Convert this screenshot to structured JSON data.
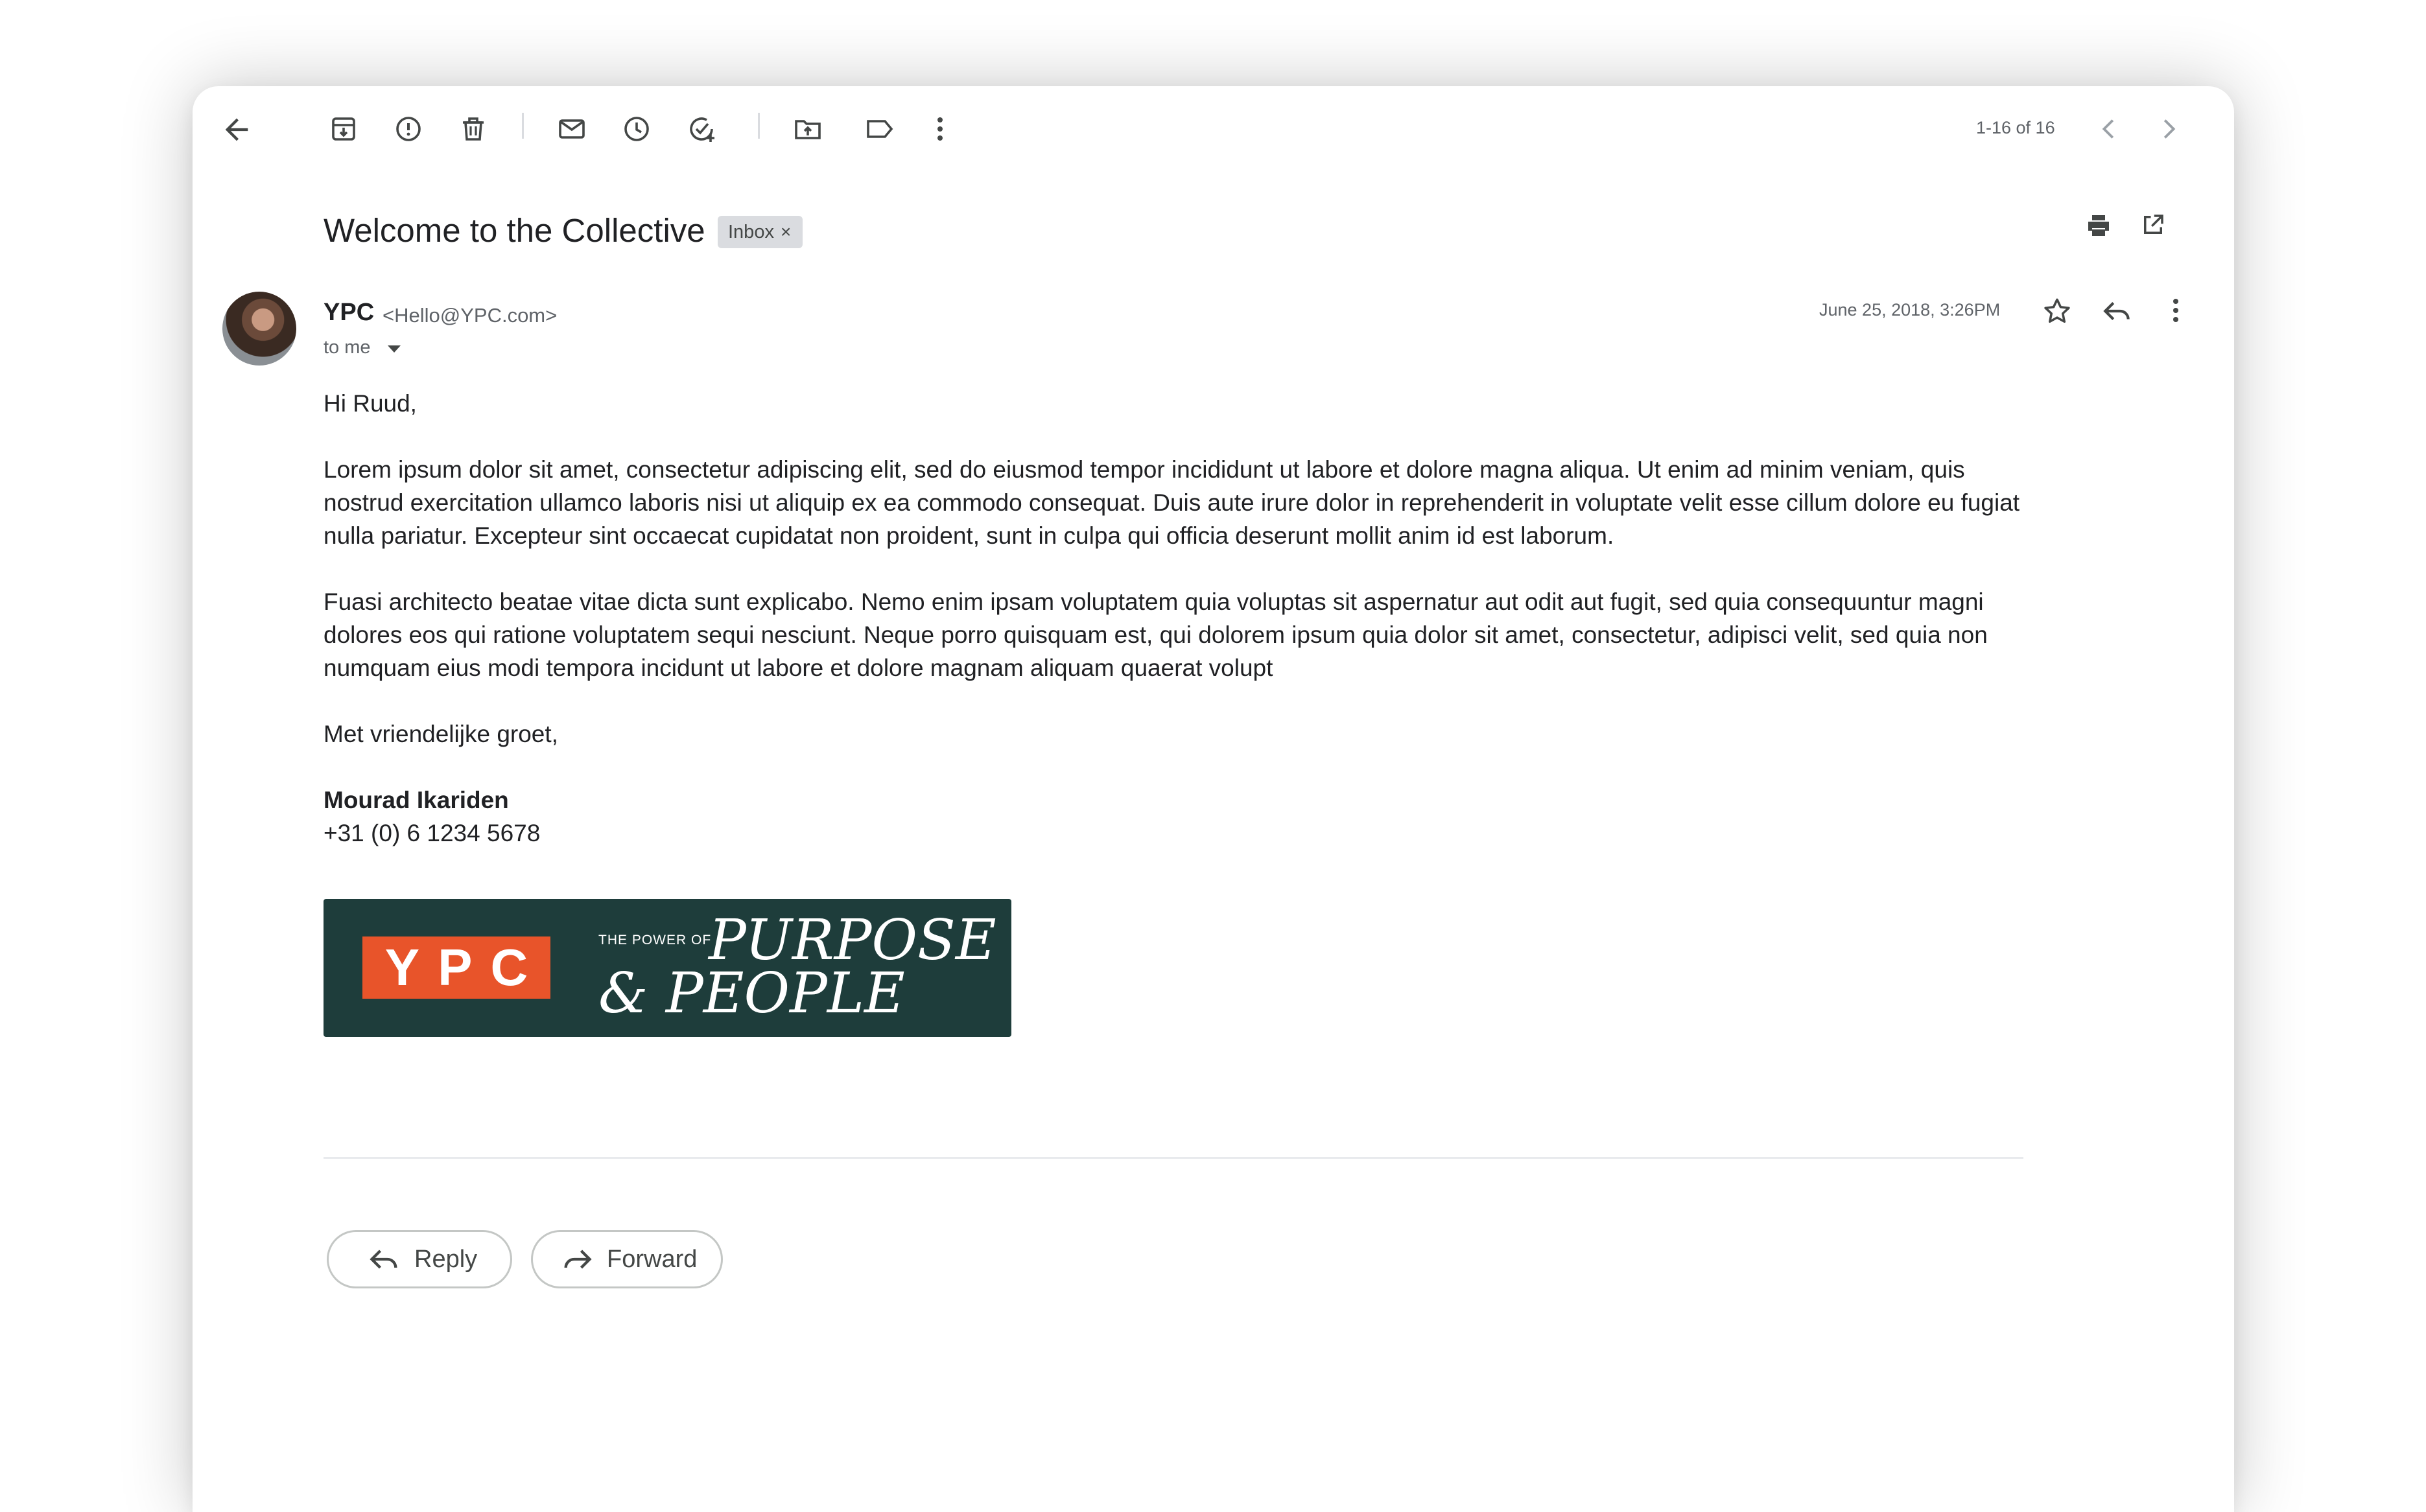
{
  "toolbar": {
    "icons": [
      "back-arrow-icon",
      "archive-icon",
      "report-spam-icon",
      "delete-icon",
      "mark-unread-icon",
      "snooze-icon",
      "add-task-icon",
      "move-to-icon",
      "label-icon",
      "more-vert-icon"
    ],
    "pager": "1-16 of 16"
  },
  "message": {
    "subject": "Welcome to the Collective",
    "label": "Inbox",
    "label_close": "×",
    "sender_name": "YPC",
    "sender_email": "<Hello@YPC.com>",
    "recipient": "to me",
    "date": "June 25, 2018, 3:26PM",
    "greeting": "Hi Ruud,",
    "paragraph1": "Lorem ipsum dolor sit amet, consectetur adipiscing elit, sed do eiusmod tempor incididunt ut labore et dolore magna aliqua. Ut enim ad minim veniam, quis nostrud exercitation ullamco laboris nisi ut aliquip ex ea commodo consequat. Duis aute irure dolor in reprehenderit in voluptate velit esse cillum dolore eu fugiat nulla pariatur. Excepteur sint occaecat cupidatat non proident, sunt in culpa qui officia deserunt mollit anim id est laborum.",
    "paragraph2": "Fuasi architecto beatae vitae dicta sunt explicabo. Nemo enim ipsam voluptatem quia voluptas sit aspernatur aut odit aut fugit, sed quia consequuntur magni dolores eos qui ratione voluptatem sequi nesciunt. Neque porro quisquam est, qui dolorem ipsum quia dolor sit amet, consectetur, adipisci velit, sed quia non numquam eius modi tempora incidunt ut labore et dolore magnam aliquam quaerat volupt",
    "closing": "Met vriendelijke groet,",
    "signature_name": "Mourad Ikariden",
    "signature_phone": "+31 (0) 6 1234 5678"
  },
  "banner": {
    "logo": "YPC",
    "tagline_small": "THE POWER OF",
    "tagline_line1": "PURPOSE",
    "tagline_line2": "& PEOPLE",
    "bg_color": "#1e3d3b",
    "accent_color": "#e8542a"
  },
  "actions": {
    "reply": "Reply",
    "forward": "Forward"
  }
}
